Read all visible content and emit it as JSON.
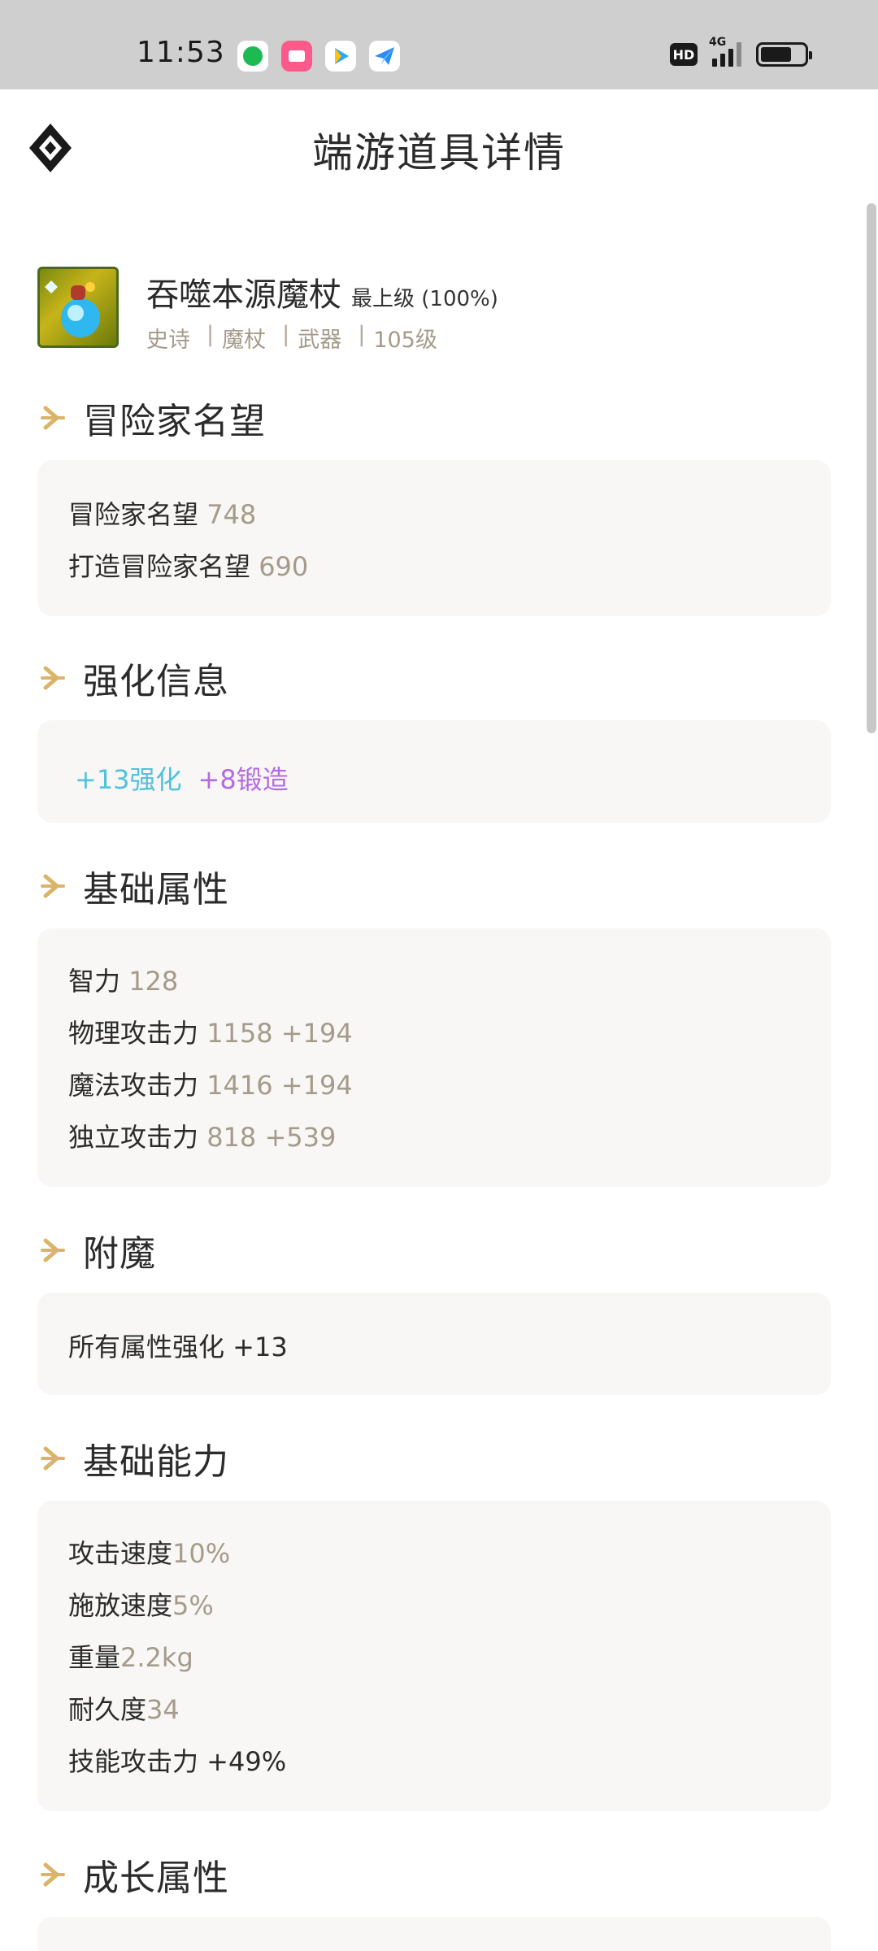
{
  "status_bar": {
    "time": "11:53",
    "network_badge": "HD",
    "network_type": "4G",
    "apps": [
      {
        "icon": "music-app-icon",
        "color": "#1db954"
      },
      {
        "icon": "video-app-icon",
        "color": "#fb5a8a"
      },
      {
        "icon": "player-app-icon",
        "color": "#2aa7ff"
      },
      {
        "icon": "send-app-icon",
        "color": "#2d8cf0"
      }
    ]
  },
  "header": {
    "title": "端游道具详情",
    "logo_icon": "diamond-logo-icon"
  },
  "item": {
    "name": "吞噬本源魔杖",
    "grade": "最上级 (100%)",
    "tags": [
      "史诗",
      "魔杖",
      "武器",
      "105级"
    ]
  },
  "sections": {
    "adventurer_fame": {
      "title": "冒险家名望",
      "rows": [
        {
          "label": "冒险家名望",
          "value": "748"
        },
        {
          "label": "打造冒险家名望",
          "value": "690"
        }
      ]
    },
    "reinforce": {
      "title": "强化信息",
      "reinforce_text": "+13强化",
      "forge_text": "+8锻造"
    },
    "base_stats": {
      "title": "基础属性",
      "rows": [
        {
          "label": "智力",
          "value": "128"
        },
        {
          "label": "物理攻击力",
          "value": "1158 +194"
        },
        {
          "label": "魔法攻击力",
          "value": "1416 +194"
        },
        {
          "label": "独立攻击力",
          "value": "818 +539"
        }
      ]
    },
    "enchant": {
      "title": "附魔",
      "text": "所有属性强化 +13"
    },
    "base_abilities": {
      "title": "基础能力",
      "rows": [
        {
          "label": "攻击速度",
          "value": "10%"
        },
        {
          "label": "施放速度",
          "value": "5%"
        },
        {
          "label": "重量",
          "value": "2.2kg"
        },
        {
          "label": "耐久度",
          "value": "34"
        }
      ],
      "skill_text": "技能攻击力 +49%"
    },
    "growth": {
      "title": "成长属性"
    }
  },
  "colors": {
    "accent_gold": "#d9b46a",
    "value_gray": "#a59b8b",
    "reinforce_cyan": "#4fc3dc",
    "forge_purple": "#b36ae2"
  }
}
